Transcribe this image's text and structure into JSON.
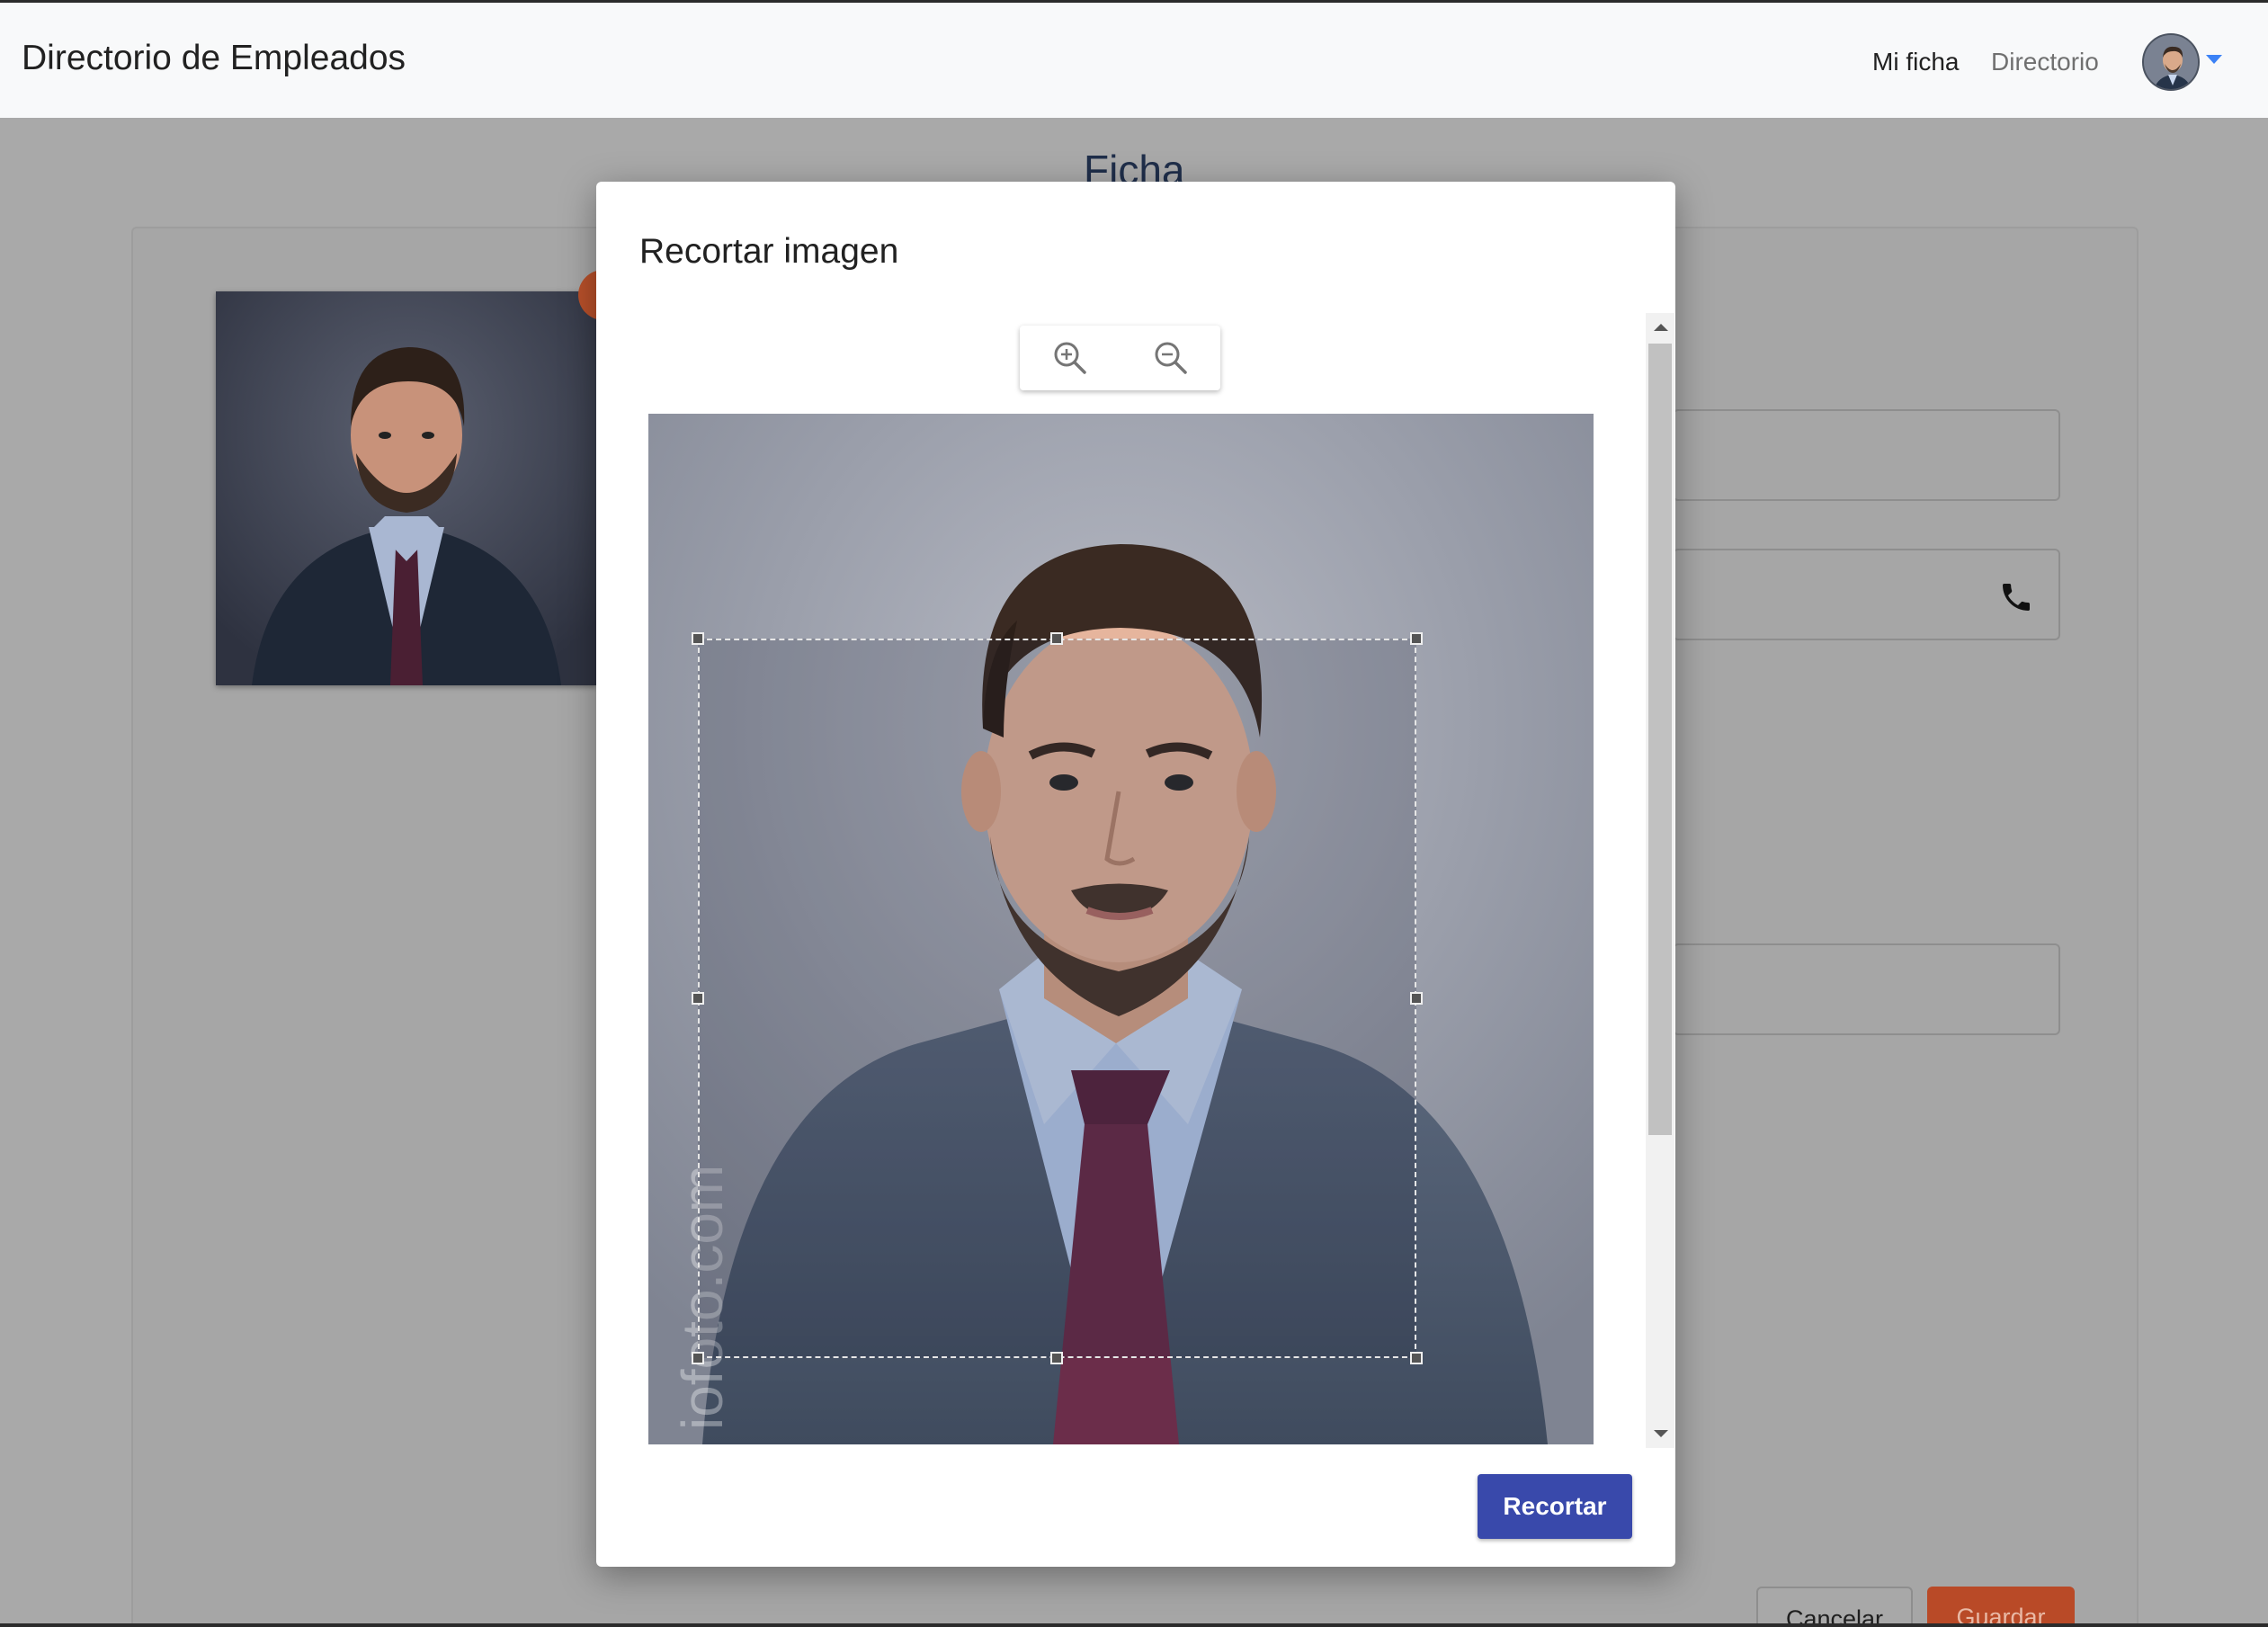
{
  "navbar": {
    "brand": "Directorio de Empleados",
    "links": [
      "Mi ficha",
      "Directorio"
    ],
    "avatar_icon": "user-avatar",
    "dropdown_icon": "caret-down-icon"
  },
  "page": {
    "title": "Ficha",
    "buttons": {
      "cancel": "Cancelar",
      "save": "Guardar"
    },
    "accent_color": "#b94a27"
  },
  "modal": {
    "title": "Recortar imagen",
    "zoom_in_icon": "zoom-in-icon",
    "zoom_out_icon": "zoom-out-icon",
    "crop_button": "Recortar",
    "crop_button_color": "#3949ab",
    "watermark": "iofoto.com"
  }
}
